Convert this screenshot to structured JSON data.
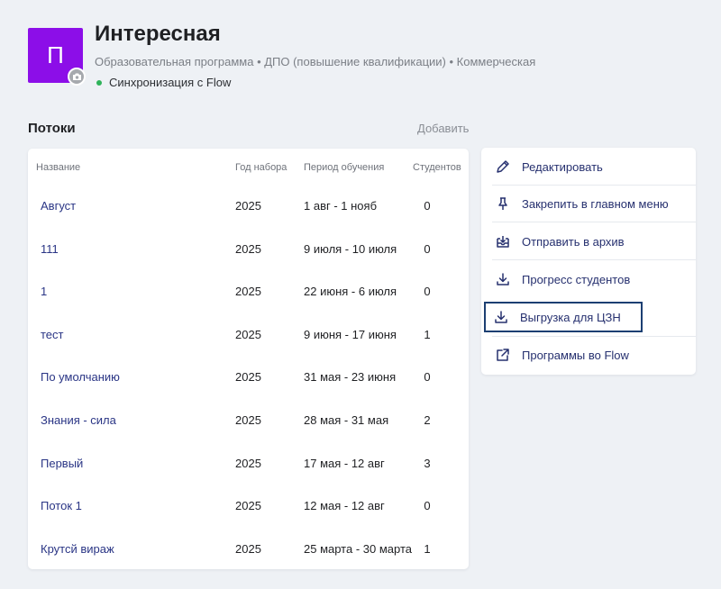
{
  "header": {
    "avatar_letter": "П",
    "avatar_color": "#8c0ee8",
    "title": "Интересная",
    "subtitle": "Образовательная программа • ДПО (повышение квалификации) • Коммерческая",
    "sync_label": "Синхронизация с Flow",
    "sync_color": "#2fb35a"
  },
  "streams": {
    "title": "Потоки",
    "add_label": "Добавить",
    "columns": {
      "name": "Название",
      "year": "Год набора",
      "period": "Период обучения",
      "students": "Студентов"
    },
    "rows": [
      {
        "name": "Август",
        "year": "2025",
        "period": "1 авг - 1 нояб",
        "students": "0"
      },
      {
        "name": "111",
        "year": "2025",
        "period": "9 июля - 10 июля",
        "students": "0"
      },
      {
        "name": "1",
        "year": "2025",
        "period": "22 июня - 6 июля",
        "students": "0"
      },
      {
        "name": "тест",
        "year": "2025",
        "period": "9 июня - 17 июня",
        "students": "1"
      },
      {
        "name": "По умолчанию",
        "year": "2025",
        "period": "31 мая - 23 июня",
        "students": "0"
      },
      {
        "name": "Знания - сила",
        "year": "2025",
        "period": "28 мая - 31 мая",
        "students": "2"
      },
      {
        "name": "Первый",
        "year": "2025",
        "period": "17 мая - 12 авг",
        "students": "3"
      },
      {
        "name": "Поток 1",
        "year": "2025",
        "period": "12 мая - 12 авг",
        "students": "0"
      },
      {
        "name": "Крутсй вираж",
        "year": "2025",
        "period": "25 марта - 30 марта",
        "students": "1"
      }
    ]
  },
  "actions": {
    "edit": "Редактировать",
    "pin": "Закрепить в главном меню",
    "archive": "Отправить в архив",
    "progress": "Прогресс студентов",
    "czn_export": "Выгрузка для ЦЗН",
    "flow_programs": "Программы во Flow"
  },
  "colors": {
    "link": "#2a3585",
    "highlight_border": "#1c3f72",
    "background": "#eef1f5"
  }
}
